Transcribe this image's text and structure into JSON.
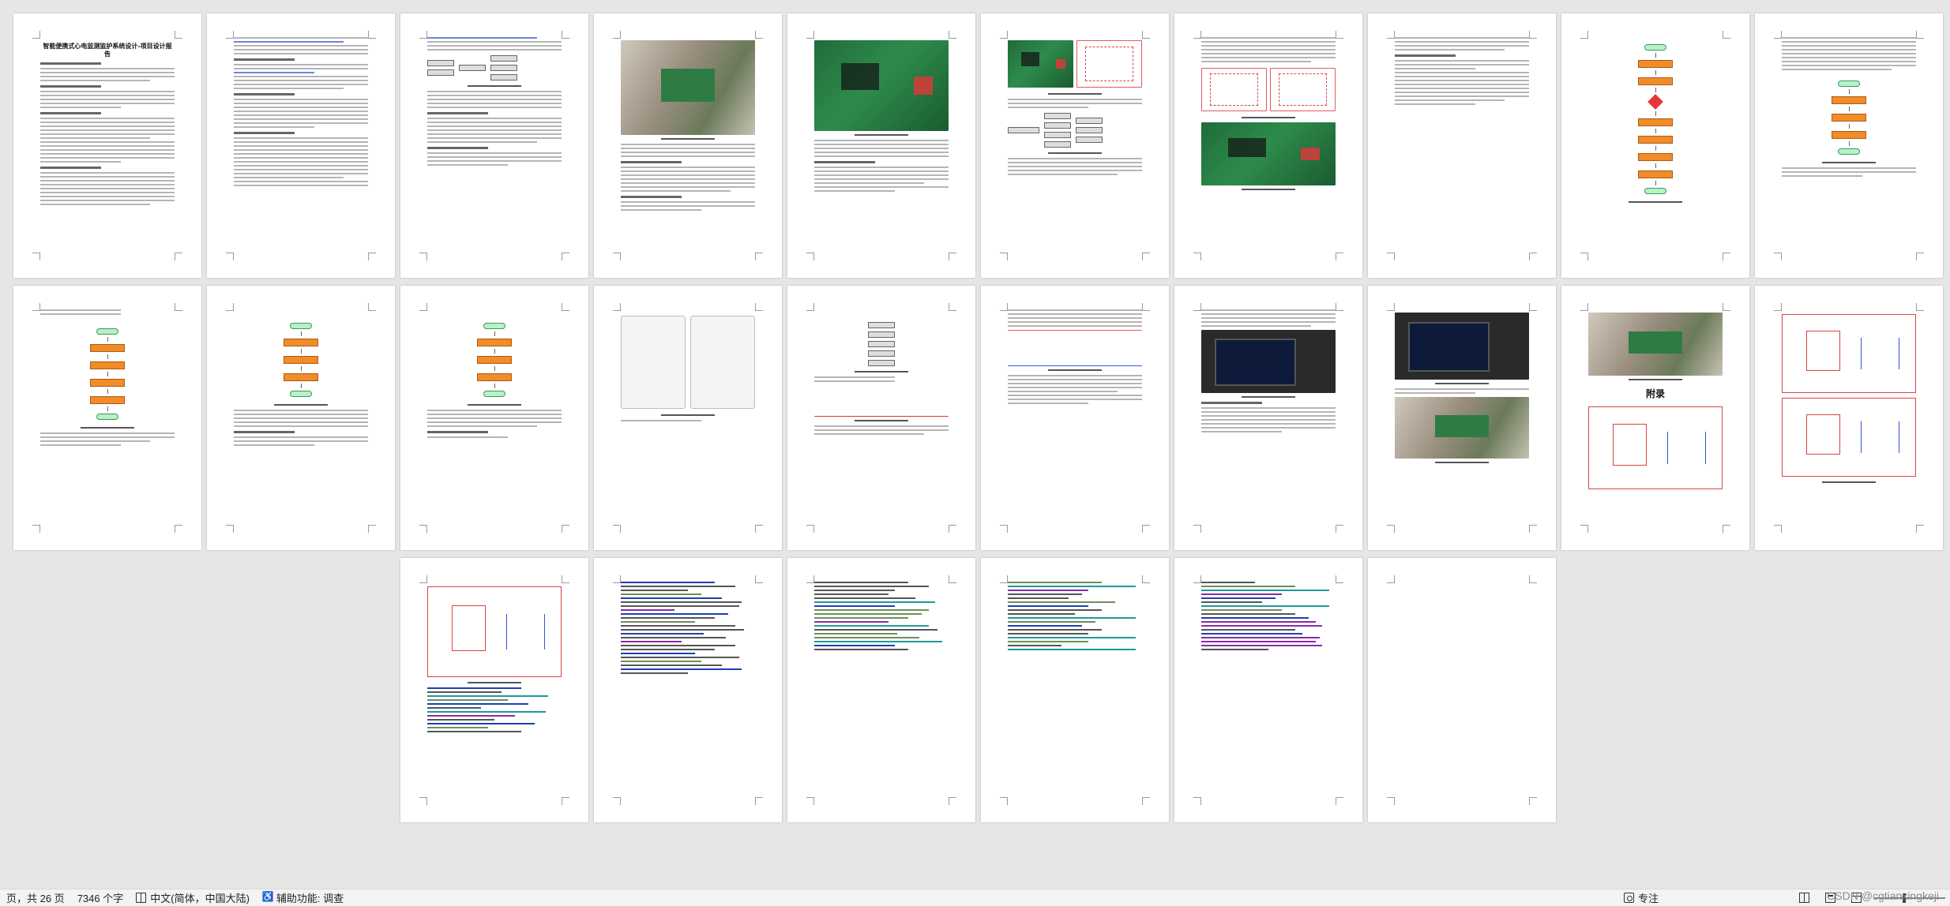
{
  "document": {
    "title": "智能便携式心电监测监护系统设计-项目设计报告",
    "appendix_heading": "附录"
  },
  "status_bar": {
    "page_info": "页，共 26 页",
    "word_count": "7346 个字",
    "language": "中文(简体，中国大陆)",
    "accessibility": "辅助功能: 调查",
    "focus_label": "专注"
  },
  "watermark": "CSDN @cgtianxingkeji",
  "colors": {
    "flow_start": "#b8f0c8",
    "flow_box": "#f08c2a",
    "flow_decision": "#e8353a",
    "schematic_border": "#d54545",
    "code_keyword": "#1d3fb8"
  }
}
